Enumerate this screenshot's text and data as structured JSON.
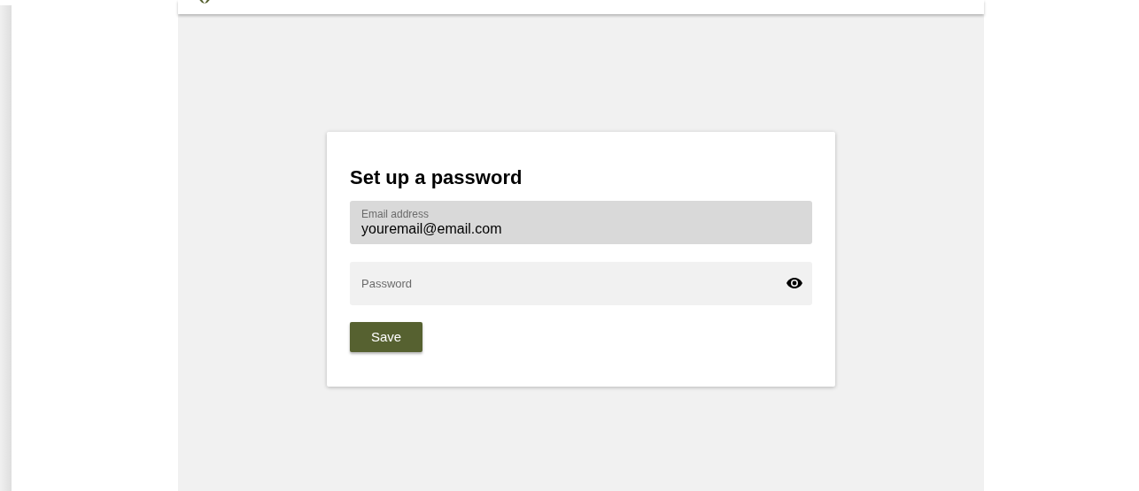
{
  "form": {
    "title": "Set up a password",
    "fields": [
      {
        "kind": "email",
        "label": "Email address",
        "value": "youremail@email.com",
        "disabled": true
      },
      {
        "kind": "password",
        "placeholder": "Password",
        "disabled": false
      }
    ],
    "submit": "Save"
  }
}
